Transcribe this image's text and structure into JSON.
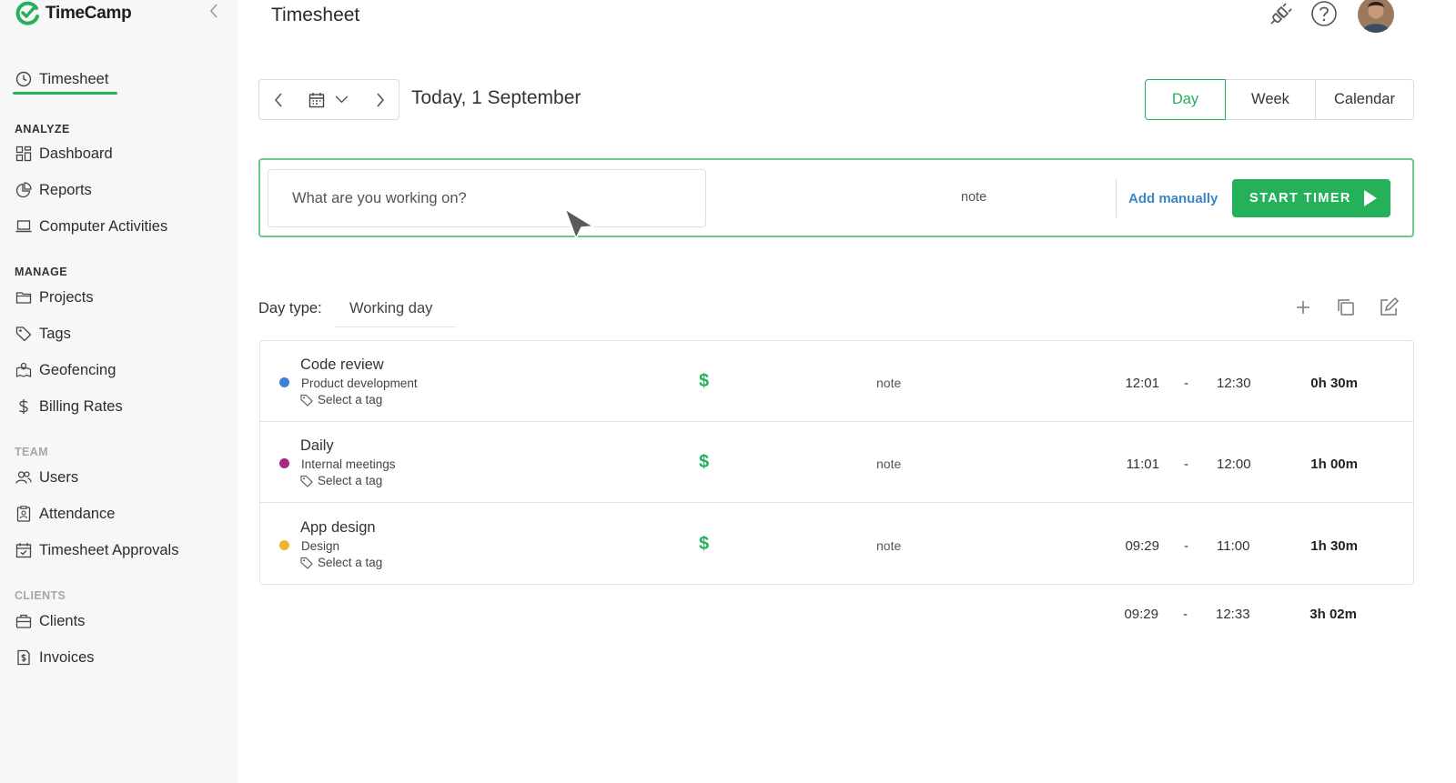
{
  "app": {
    "name": "TimeCamp"
  },
  "sidebar": {
    "active": {
      "label": "Timesheet"
    },
    "sections": {
      "analyze": "ANALYZE",
      "manage": "MANAGE",
      "team": "TEAM",
      "clients": "CLIENTS"
    },
    "items": {
      "dashboard": "Dashboard",
      "reports": "Reports",
      "computer_activities": "Computer Activities",
      "projects": "Projects",
      "tags": "Tags",
      "geofencing": "Geofencing",
      "billing_rates": "Billing Rates",
      "users": "Users",
      "attendance": "Attendance",
      "timesheet_approvals": "Timesheet Approvals",
      "clients": "Clients",
      "invoices": "Invoices"
    }
  },
  "header": {
    "title": "Timesheet"
  },
  "date_nav": {
    "title": "Today, 1 September"
  },
  "view_switch": {
    "day": "Day",
    "week": "Week",
    "calendar": "Calendar",
    "selected": "Day"
  },
  "timer": {
    "placeholder": "What are you working on?",
    "note": "note",
    "add_manually": "Add manually",
    "start": "START TIMER"
  },
  "day_type": {
    "label": "Day type:",
    "value": "Working day"
  },
  "entries": [
    {
      "title": "Code review",
      "project": "Product development",
      "tag": "Select a tag",
      "note": "note",
      "start": "12:01",
      "dash": "-",
      "end": "12:30",
      "duration": "0h 30m",
      "color": "#3b82d6",
      "billing": "$"
    },
    {
      "title": "Daily",
      "project": "Internal meetings",
      "tag": "Select a tag",
      "note": "note",
      "start": "11:01",
      "dash": "-",
      "end": "12:00",
      "duration": "1h 00m",
      "color": "#a5297f",
      "billing": "$"
    },
    {
      "title": "App design",
      "project": "Design",
      "tag": "Select a tag",
      "note": "note",
      "start": "09:29",
      "dash": "-",
      "end": "11:00",
      "duration": "1h 30m",
      "color": "#f0b429",
      "billing": "$"
    }
  ],
  "totals": {
    "start": "09:29",
    "dash": "-",
    "end": "12:33",
    "duration": "3h 02m"
  },
  "colors": {
    "accent": "#25b05a",
    "link": "#3b86c9"
  }
}
